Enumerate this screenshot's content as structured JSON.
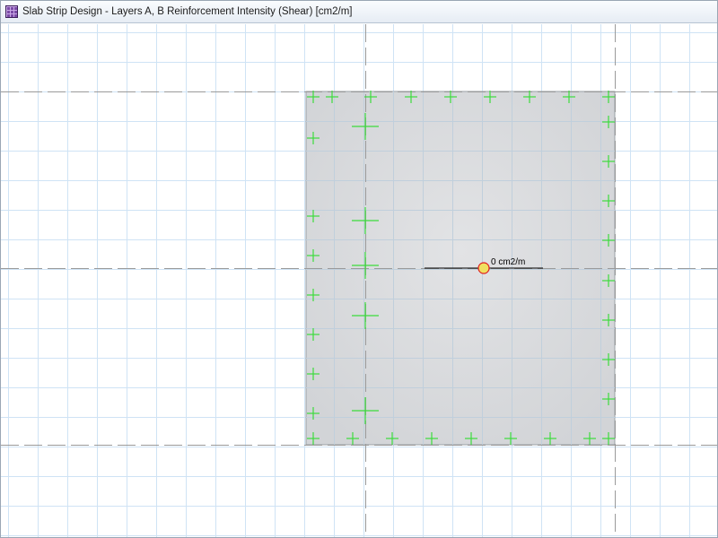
{
  "window": {
    "title": "Slab Strip Design - Layers A, B Reinforcement Intensity (Shear) [cm2/m]"
  },
  "canvas": {
    "value_label": "0 cm2/m"
  },
  "colors": {
    "grid_line": "#cfe3f5",
    "axis_line": "#9a9a9a",
    "slab_fill": "#d8dadd",
    "marker": "#3cdc3c",
    "probe_ring": "#e02020",
    "probe_fill": "#f0e060"
  },
  "icons": {
    "app": "slab-grid-icon",
    "marker": "green-plus-marker",
    "probe": "probe-circle-icon"
  }
}
